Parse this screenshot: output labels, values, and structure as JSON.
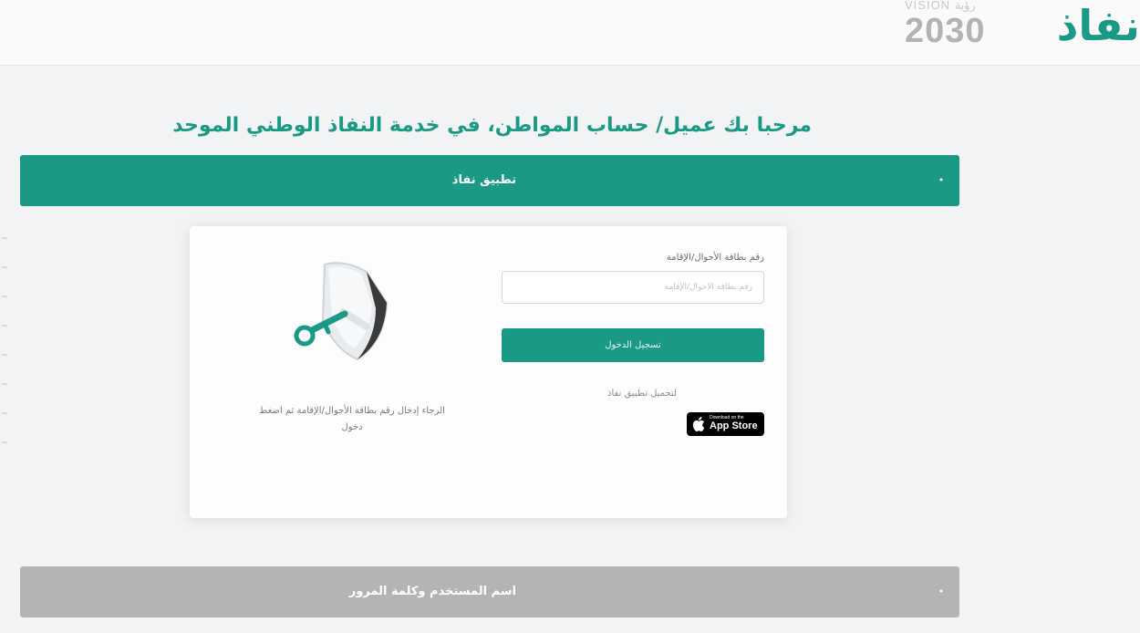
{
  "header": {
    "logo_text": "نفاذ",
    "vision_label": "VISION",
    "vision_arabic": "رؤية",
    "vision_year": "2030"
  },
  "page": {
    "title": "مرحبا بك عميل/ حساب المواطن، في خدمة النفاذ الوطني الموحد"
  },
  "sections": [
    {
      "label": "تطبيق نفاذ",
      "state": "expanded",
      "color": "#1a9a84"
    },
    {
      "label": "اسم المستخدم وكلمة المرور",
      "state": "collapsed",
      "color": "#b4b4b4"
    }
  ],
  "login_form": {
    "id_label": "رقم بطاقة الأحوال/الإقامة",
    "id_placeholder": "رقم بطاقة الأحوال/الإقامة",
    "id_value": "",
    "submit_label": "تسجيل الدخول",
    "download_label": "لتحميل تطبيق نفاذ",
    "appstore_small": "Download on the",
    "appstore_big": "App Store"
  },
  "illustration": {
    "icon": "shield-key-icon",
    "hint": "الرجاء إدخال رقم بطاقة الأحوال/الإقامة ثم اضغط دخول"
  },
  "colors": {
    "accent": "#1a9a84",
    "inactive": "#b4b4b4",
    "background": "#f2f3f5"
  }
}
